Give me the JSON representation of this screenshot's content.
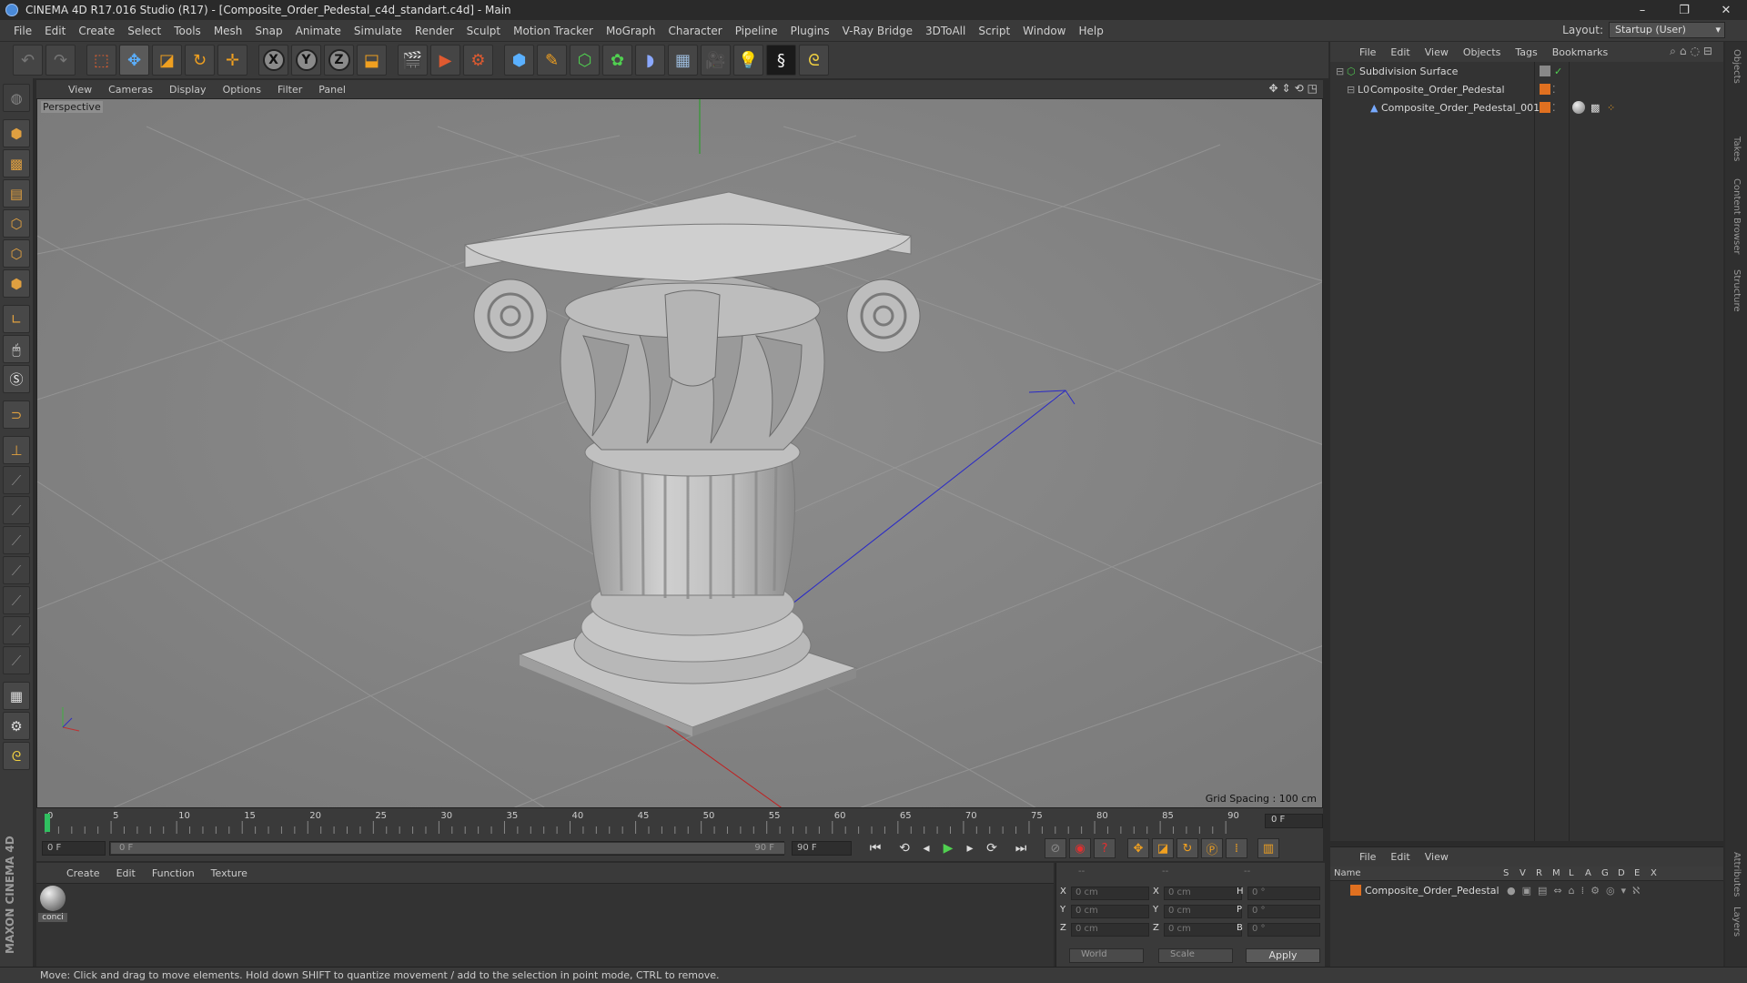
{
  "window": {
    "title": "CINEMA 4D R17.016 Studio (R17) - [Composite_Order_Pedestal_c4d_standart.c4d] - Main",
    "controls": [
      "–",
      "❐",
      "✕"
    ]
  },
  "menubar": [
    "File",
    "Edit",
    "Create",
    "Select",
    "Tools",
    "Mesh",
    "Snap",
    "Animate",
    "Simulate",
    "Render",
    "Sculpt",
    "Motion Tracker",
    "MoGraph",
    "Character",
    "Pipeline",
    "Plugins",
    "V-Ray Bridge",
    "3DToAll",
    "Script",
    "Window",
    "Help"
  ],
  "layout": {
    "label": "Layout:",
    "value": "Startup (User)"
  },
  "toolbar": {
    "axis": [
      "X",
      "Y",
      "Z"
    ]
  },
  "viewport": {
    "menu": [
      "View",
      "Cameras",
      "Display",
      "Options",
      "Filter",
      "Panel"
    ],
    "camera_label": "Perspective",
    "grid_spacing": "Grid Spacing : 100 cm"
  },
  "timeline": {
    "ticks": [
      0,
      5,
      10,
      15,
      20,
      25,
      30,
      35,
      40,
      45,
      50,
      55,
      60,
      65,
      70,
      75,
      80,
      85,
      90
    ],
    "current_frame": "0 F"
  },
  "transport": {
    "start": "0 F",
    "range_start": "0 F",
    "range_end": "90 F",
    "end": "90 F"
  },
  "material_manager": {
    "menu": [
      "Create",
      "Edit",
      "Function",
      "Texture"
    ],
    "materials": [
      {
        "name": "conci"
      }
    ]
  },
  "coordinates": {
    "header": [
      "--",
      "--",
      "--"
    ],
    "rows": [
      {
        "a": "X",
        "v1": "0 cm",
        "b": "X",
        "v2": "0 cm",
        "c": "H",
        "v3": "0 °"
      },
      {
        "a": "Y",
        "v1": "0 cm",
        "b": "Y",
        "v2": "0 cm",
        "c": "P",
        "v3": "0 °"
      },
      {
        "a": "Z",
        "v1": "0 cm",
        "b": "Z",
        "v2": "0 cm",
        "c": "B",
        "v3": "0 °"
      }
    ],
    "mode": "World",
    "scale": "Scale",
    "apply": "Apply"
  },
  "object_manager": {
    "menu": [
      "File",
      "Edit",
      "View",
      "Objects",
      "Tags",
      "Bookmarks"
    ],
    "objects": [
      {
        "name": "Subdivision Surface",
        "color": "#4fc04f"
      },
      {
        "name": "Composite_Order_Pedestal",
        "color": "#cccccc"
      },
      {
        "name": "Composite_Order_Pedestal_001",
        "color": "#77aaff"
      }
    ]
  },
  "layer_manager": {
    "menu": [
      "File",
      "Edit",
      "View"
    ],
    "columns": [
      "Name",
      "S",
      "V",
      "R",
      "M",
      "L",
      "A",
      "G",
      "D",
      "E",
      "X"
    ],
    "layers": [
      {
        "name": "Composite_Order_Pedestal",
        "color": "#e07020"
      }
    ]
  },
  "side_tabs": [
    "Objects",
    "Takes",
    "Content Browser",
    "Structure",
    "Attributes",
    "Layers"
  ],
  "branding": "MAXON CINEMA 4D",
  "status": "Move: Click and drag to move elements. Hold down SHIFT to quantize movement / add to the selection in point mode, CTRL to remove."
}
